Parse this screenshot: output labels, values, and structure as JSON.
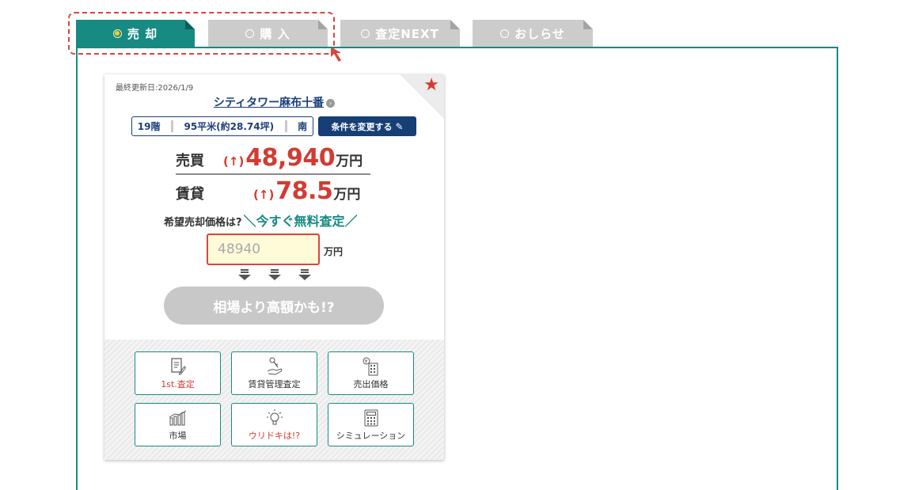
{
  "tabs": [
    {
      "label": "売 却",
      "active": true
    },
    {
      "label": "購 入",
      "active": false
    },
    {
      "label": "査定NEXT",
      "active": false
    },
    {
      "label": "おしらせ",
      "active": false
    }
  ],
  "colors": {
    "accent": "#178a82",
    "navy": "#153f75",
    "price_red": "#d33b32",
    "highlight_dash": "#d8473b",
    "inactive_tab": "#cccccc"
  },
  "card": {
    "updated": "最終更新日:2026/1/9",
    "building_name": "シティタワー麻布十番",
    "conditions": {
      "floor": "19階",
      "area": "95平米(約28.74坪)",
      "direction": "南"
    },
    "change_button": "条件を変更する",
    "sale": {
      "label": "売買",
      "arrow": "↑",
      "value": "48,940",
      "unit": "万円"
    },
    "rent": {
      "label": "賃貸",
      "arrow": "↑",
      "value": "78.5",
      "unit": "万円"
    },
    "hope_question": "希望売却価格は?",
    "hope_cta": "＼今すぐ無料査定／",
    "input": {
      "placeholder": "48940",
      "unit": "万円"
    },
    "estimate_button": "相場より高額かも!?",
    "menu": [
      {
        "label": "1st.査定",
        "icon": "document-pen-icon",
        "highlight": true
      },
      {
        "label": "賃貸管理査定",
        "icon": "hand-key-icon",
        "highlight": false
      },
      {
        "label": "売出価格",
        "icon": "yen-building-icon",
        "highlight": false
      },
      {
        "label": "市場",
        "icon": "bar-chart-icon",
        "highlight": false
      },
      {
        "label": "ウリドキは!?",
        "icon": "lightbulb-icon",
        "highlight": true
      },
      {
        "label": "シミュレーション",
        "icon": "calculator-icon",
        "highlight": false
      }
    ]
  }
}
